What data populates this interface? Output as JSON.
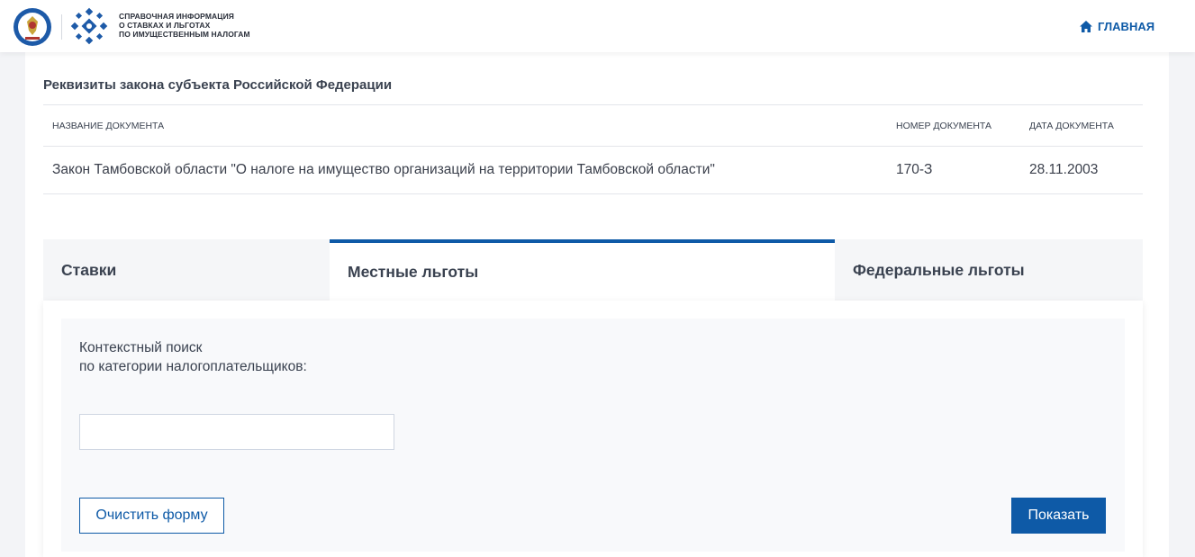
{
  "header": {
    "logo_lines": [
      "СПРАВОЧНАЯ ИНФОРМАЦИЯ",
      "О СТАВКАХ И ЛЬГОТАХ",
      "ПО ИМУЩЕСТВЕННЫМ НАЛОГАМ"
    ],
    "nav_home": "ГЛАВНАЯ",
    "accent_color": "#0e5aa7"
  },
  "law_section": {
    "title": "Реквизиты закона субъекта Российской Федерации",
    "columns": [
      "НАЗВАНИЕ ДОКУМЕНТА",
      "НОМЕР ДОКУМЕНТА",
      "ДАТА ДОКУМЕНТА"
    ],
    "rows": [
      [
        "Закон Тамбовской области \"О налоге на имущество организаций на территории Тамбовской области\"",
        "170-З",
        "28.11.2003"
      ]
    ]
  },
  "tabs": [
    {
      "label": "Ставки",
      "active": false
    },
    {
      "label": "Местные льготы",
      "active": true
    },
    {
      "label": "Федеральные льготы",
      "active": false
    }
  ],
  "search_panel": {
    "label_lines": [
      "Контекстный поиск",
      "по категории налогоплательщиков:"
    ],
    "input_value": "",
    "clear_button": "Очистить форму",
    "show_button": "Показать"
  }
}
